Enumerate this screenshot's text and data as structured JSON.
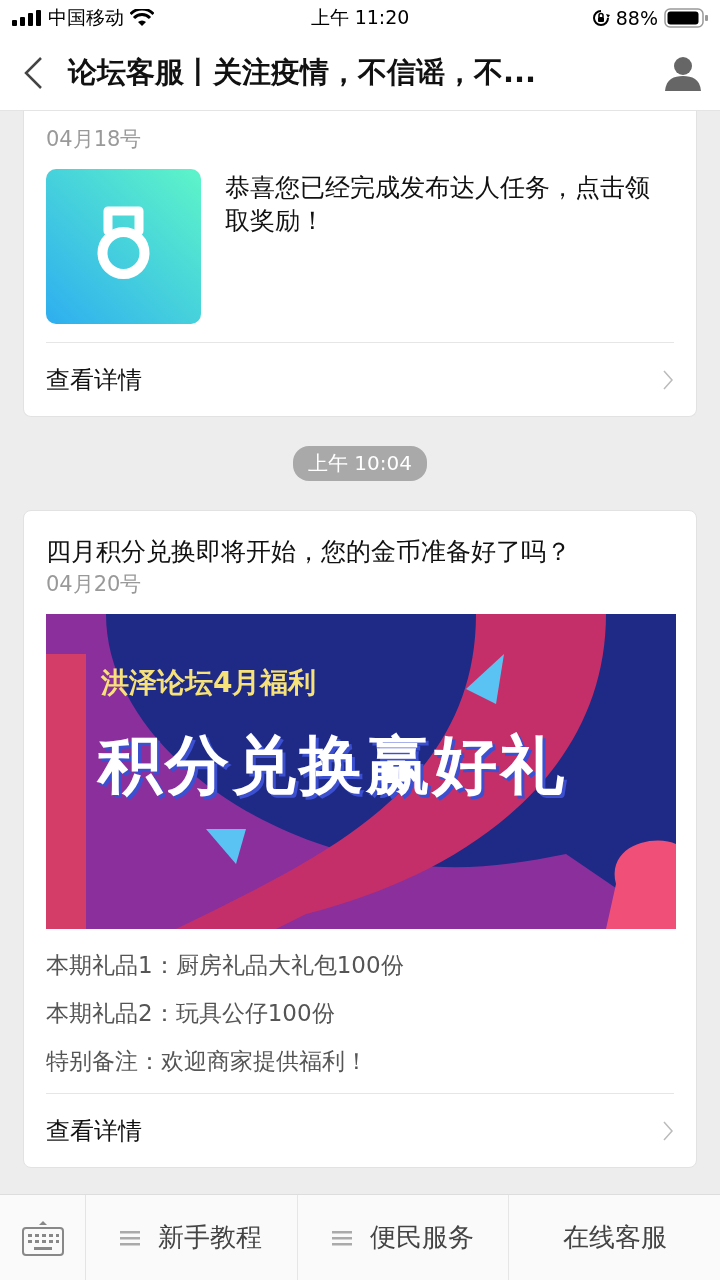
{
  "status_bar": {
    "carrier": "中国移动",
    "time": "上午 11:20",
    "battery": "88%"
  },
  "header": {
    "title": "论坛客服丨关注疫情，不信谣，不..."
  },
  "messages": [
    {
      "kind": "icon_card",
      "date": "04月18号",
      "text": "恭喜您已经完成发布达人任务，点击领取奖励！",
      "link": "查看详情"
    },
    {
      "kind": "timestamp",
      "time": "上午 10:04"
    },
    {
      "kind": "banner_card",
      "title": "四月积分兑换即将开始，您的金币准备好了吗？",
      "date": "04月20号",
      "banner": {
        "subtitle": "洪泽论坛4月福利",
        "headline": "积分兑换赢好礼"
      },
      "lines": [
        "本期礼品1：厨房礼品大礼包100份",
        "本期礼品2：玩具公仔100份",
        "特别备注：欢迎商家提供福利！"
      ],
      "link": "查看详情"
    }
  ],
  "menu_bar": {
    "items": [
      {
        "label": "新手教程",
        "has_submenu": true
      },
      {
        "label": "便民服务",
        "has_submenu": true
      },
      {
        "label": "在线客服",
        "has_submenu": false
      }
    ]
  }
}
